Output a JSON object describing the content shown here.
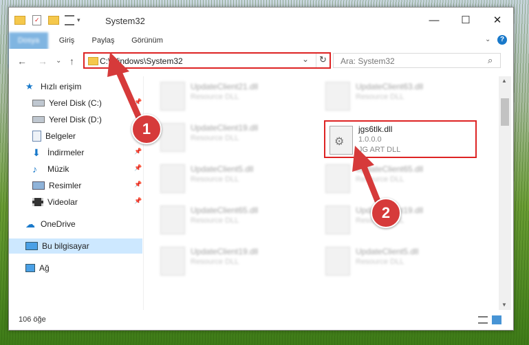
{
  "window": {
    "title": "System32",
    "min_glyph": "—",
    "max_glyph": "☐",
    "close_glyph": "✕"
  },
  "ribbon": {
    "tabs": [
      "Dosya",
      "Giriş",
      "Paylaş",
      "Görünüm"
    ],
    "help_glyph": "?"
  },
  "nav": {
    "back_glyph": "←",
    "forward_glyph": "→",
    "recent_glyph": "⌄",
    "up_glyph": "↑"
  },
  "address": {
    "path": "C:\\Windows\\System32",
    "dropdown_glyph": "⌄",
    "refresh_glyph": "↻"
  },
  "search": {
    "placeholder": "Ara: System32",
    "icon_glyph": "⌕"
  },
  "sidebar": {
    "items": [
      {
        "label": "Hızlı erişim",
        "icon": "star-icon",
        "pinned": false
      },
      {
        "label": "Yerel Disk (C:)",
        "icon": "drive-icon",
        "pinned": true
      },
      {
        "label": "Yerel Disk (D:)",
        "icon": "drive-icon",
        "pinned": true
      },
      {
        "label": "Belgeler",
        "icon": "document-icon",
        "pinned": true
      },
      {
        "label": "İndirmeler",
        "icon": "download-icon",
        "pinned": true
      },
      {
        "label": "Müzik",
        "icon": "music-icon",
        "pinned": true
      },
      {
        "label": "Resimler",
        "icon": "picture-icon",
        "pinned": true
      },
      {
        "label": "Videolar",
        "icon": "video-icon",
        "pinned": true
      },
      {
        "label": "OneDrive",
        "icon": "cloud-icon",
        "pinned": false
      },
      {
        "label": "Bu bilgisayar",
        "icon": "computer-icon",
        "pinned": false
      },
      {
        "label": "Ağ",
        "icon": "network-icon",
        "pinned": false
      }
    ],
    "pin_glyph": "📌"
  },
  "files": {
    "left": [
      {
        "name": "UpdateClient21.dll",
        "desc": "Resource DLL"
      },
      {
        "name": "UpdateClient19.dll",
        "desc": "Resource DLL"
      },
      {
        "name": "UpdateClient5.dll",
        "desc": "Resource DLL"
      },
      {
        "name": "UpdateClient65.dll",
        "desc": "Resource DLL"
      },
      {
        "name": "UpdateClient19.dll",
        "desc": "Resource DLL"
      }
    ],
    "right": [
      {
        "name": "UpdateClient63.dll",
        "desc": "Resource DLL"
      },
      {
        "name": "UpdateClient65.dll",
        "desc": "Resource DLL"
      },
      {
        "name": "UpdateClient19.dll",
        "desc": "Resource DLL"
      },
      {
        "name": "UpdateClient5.dll",
        "desc": "Resource DLL"
      }
    ],
    "highlighted": {
      "name": "jgs6tlk.dll",
      "version": "1.0.0.0",
      "desc": "JG ART DLL"
    }
  },
  "status": {
    "count": "106 öğe"
  },
  "annotations": {
    "badge1": "1",
    "badge2": "2",
    "color": "#d63a3a"
  }
}
